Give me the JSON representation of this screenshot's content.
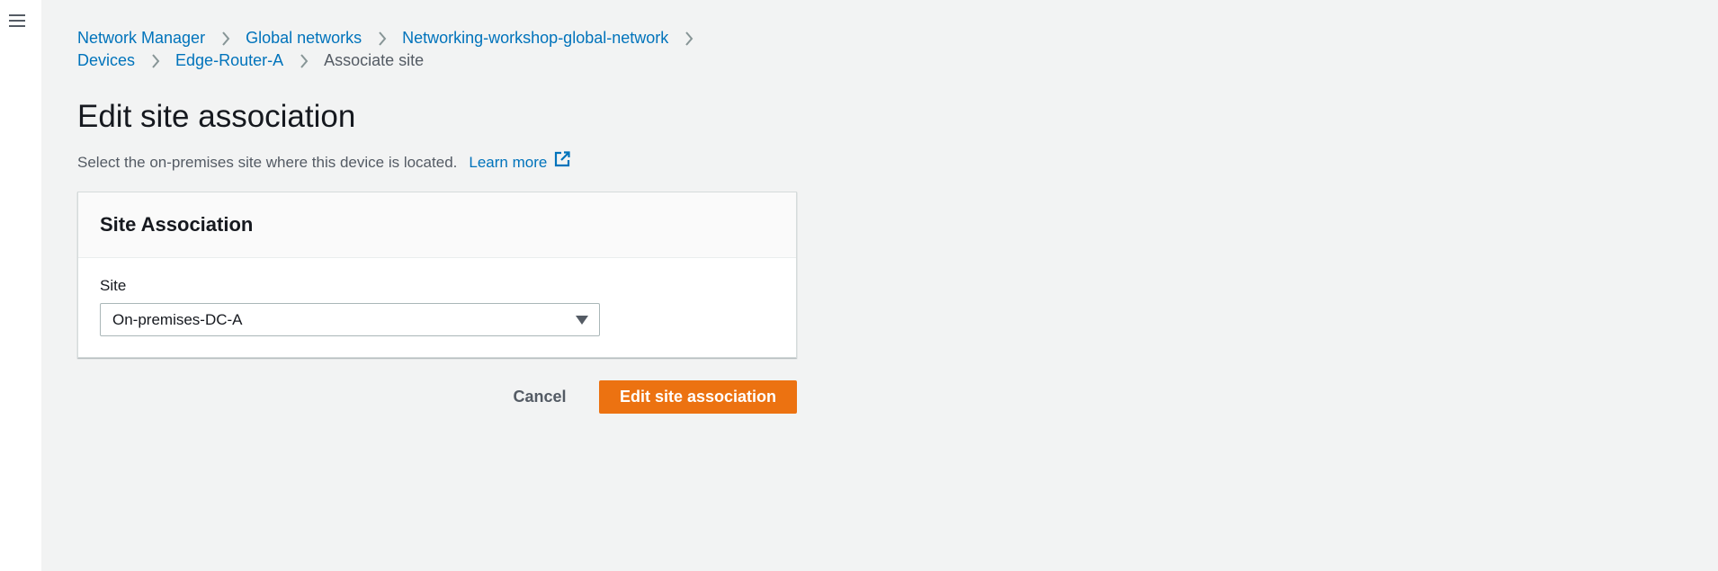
{
  "nav": {
    "menu_icon": "hamburger-menu-icon"
  },
  "breadcrumbs": {
    "row1": [
      "Network Manager",
      "Global networks",
      "Networking-workshop-global-network"
    ],
    "row2": [
      "Devices",
      "Edge-Router-A"
    ],
    "current": "Associate site"
  },
  "page": {
    "title": "Edit site association",
    "description": "Select the on-premises site where this device is located.",
    "learn_more": "Learn more",
    "learn_more_icon": "external-link-icon"
  },
  "panel": {
    "title": "Site Association",
    "site_label": "Site",
    "site_value": "On-premises-DC-A"
  },
  "actions": {
    "cancel": "Cancel",
    "submit": "Edit site association"
  },
  "colors": {
    "link": "#0073bb",
    "primary": "#ec7211",
    "background": "#f2f3f3"
  }
}
